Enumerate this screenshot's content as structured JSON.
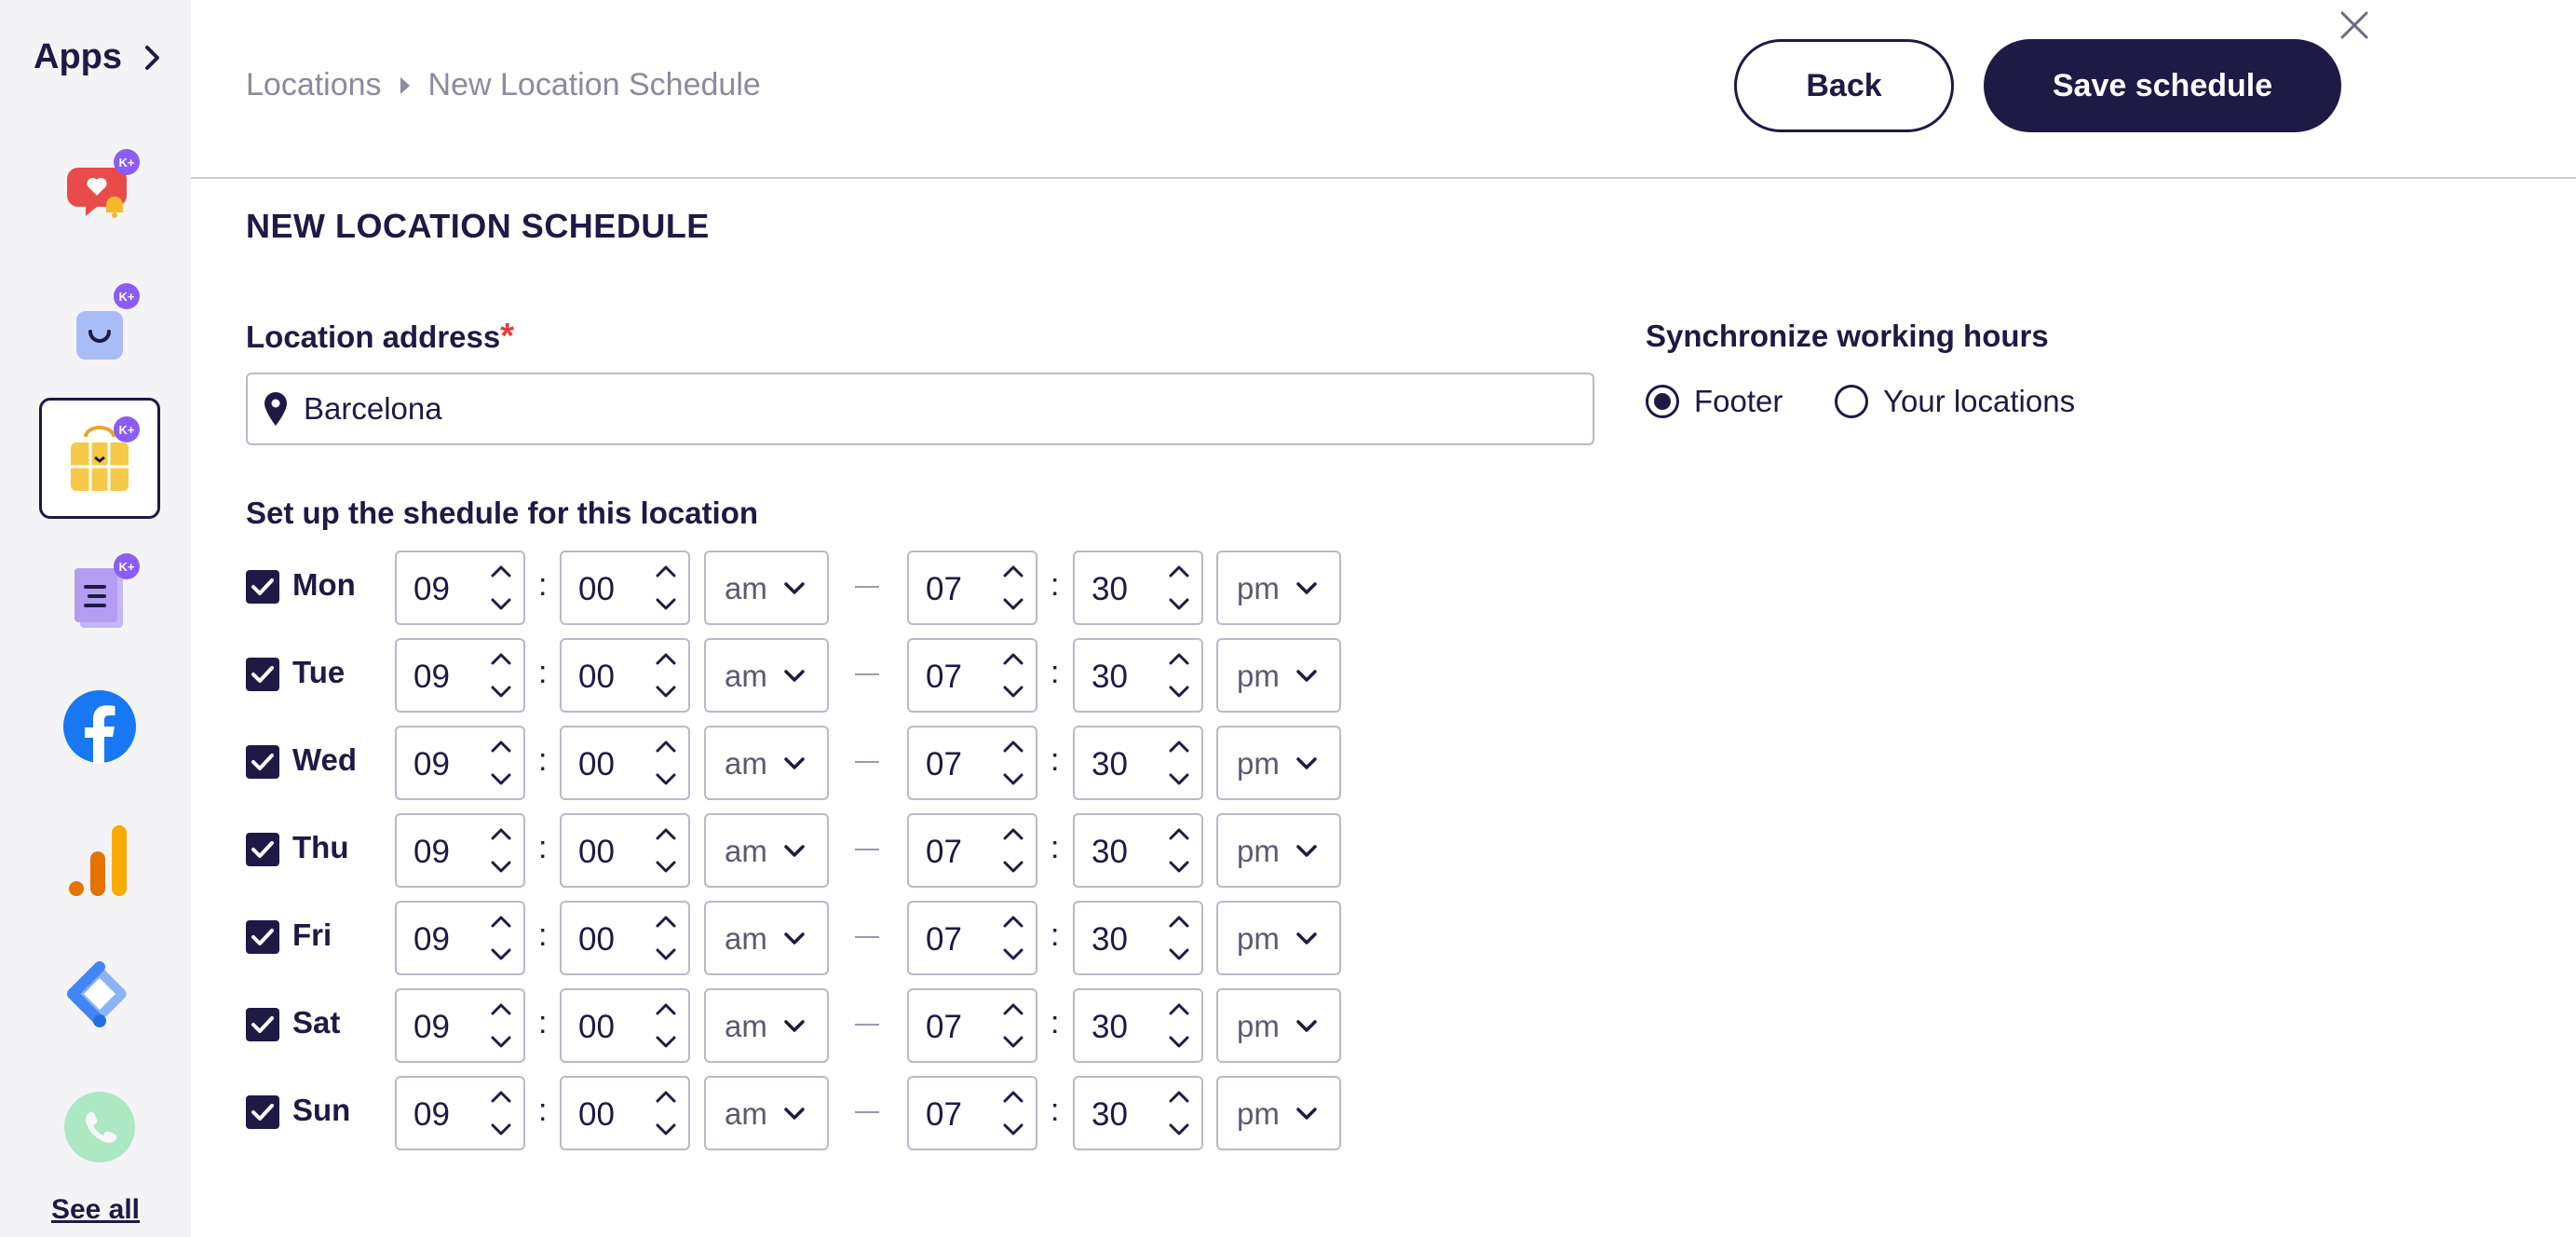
{
  "sidebar": {
    "title": "Apps",
    "see_all": "See all",
    "apps": [
      {
        "name": "notification-app",
        "badge": "K+"
      },
      {
        "name": "shop-app",
        "badge": "K+"
      },
      {
        "name": "schedule-app",
        "badge": "K+",
        "active": true
      },
      {
        "name": "forms-app",
        "badge": "K+"
      },
      {
        "name": "facebook-app"
      },
      {
        "name": "analytics-app"
      },
      {
        "name": "tag-manager-app"
      },
      {
        "name": "whatsapp-app"
      }
    ]
  },
  "header": {
    "breadcrumb": [
      "Locations",
      "New Location Schedule"
    ],
    "back_label": "Back",
    "save_label": "Save schedule"
  },
  "main": {
    "title": "NEW LOCATION SCHEDULE",
    "address_label": "Location address",
    "required_mark": "*",
    "address_value": "Barcelona",
    "sync_label": "Synchronize working hours",
    "sync_options": [
      {
        "label": "Footer",
        "selected": true
      },
      {
        "label": "Your locations",
        "selected": false
      }
    ],
    "schedule_label": "Set up the shedule for this location",
    "days": [
      {
        "day": "Mon",
        "checked": true,
        "start_h": "09",
        "start_m": "00",
        "start_p": "am",
        "end_h": "07",
        "end_m": "30",
        "end_p": "pm"
      },
      {
        "day": "Tue",
        "checked": true,
        "start_h": "09",
        "start_m": "00",
        "start_p": "am",
        "end_h": "07",
        "end_m": "30",
        "end_p": "pm"
      },
      {
        "day": "Wed",
        "checked": true,
        "start_h": "09",
        "start_m": "00",
        "start_p": "am",
        "end_h": "07",
        "end_m": "30",
        "end_p": "pm"
      },
      {
        "day": "Thu",
        "checked": true,
        "start_h": "09",
        "start_m": "00",
        "start_p": "am",
        "end_h": "07",
        "end_m": "30",
        "end_p": "pm"
      },
      {
        "day": "Fri",
        "checked": true,
        "start_h": "09",
        "start_m": "00",
        "start_p": "am",
        "end_h": "07",
        "end_m": "30",
        "end_p": "pm"
      },
      {
        "day": "Sat",
        "checked": true,
        "start_h": "09",
        "start_m": "00",
        "start_p": "am",
        "end_h": "07",
        "end_m": "30",
        "end_p": "pm"
      },
      {
        "day": "Sun",
        "checked": true,
        "start_h": "09",
        "start_m": "00",
        "start_p": "am",
        "end_h": "07",
        "end_m": "30",
        "end_p": "pm"
      }
    ]
  },
  "colors": {
    "primary": "#1d1a45",
    "required": "#e0403c",
    "border": "#b9bac8",
    "badge": "#8b5cf6"
  }
}
